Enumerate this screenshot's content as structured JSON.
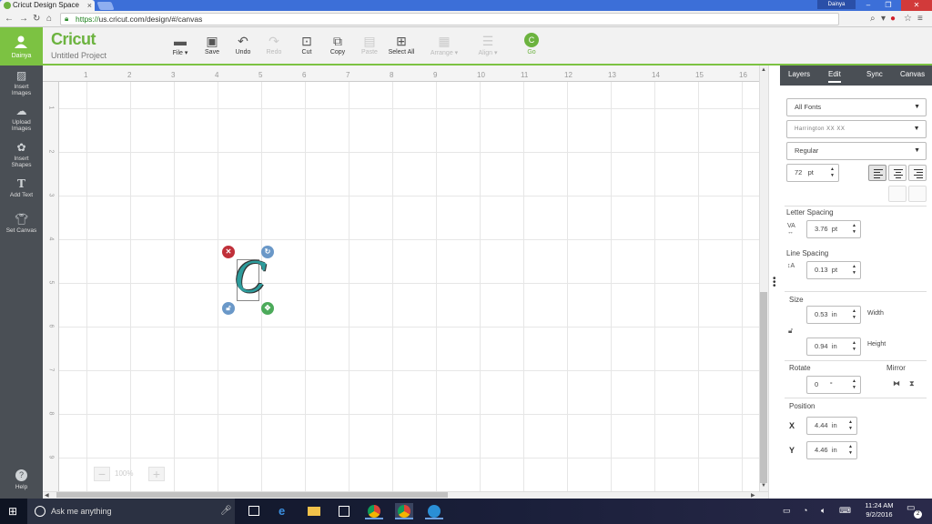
{
  "browser": {
    "tab_title": "Cricut Design Space",
    "tab_close": "×",
    "user_chip": "Dainya",
    "url_secure": "https://",
    "url_rest": "us.cricut.com/design/#/canvas"
  },
  "app": {
    "user_name": "Dainya",
    "logo": "Cricut",
    "project_title": "Untitled Project"
  },
  "toolbar": {
    "file": "File",
    "save": "Save",
    "undo": "Undo",
    "redo": "Redo",
    "cut": "Cut",
    "copy": "Copy",
    "paste": "Paste",
    "select_all": "Select All",
    "arrange": "Arrange",
    "align": "Align",
    "go": "Go"
  },
  "sidebar": {
    "items": [
      {
        "label1": "Insert",
        "label2": "Images"
      },
      {
        "label1": "Upload",
        "label2": "Images"
      },
      {
        "label1": "Insert",
        "label2": "Shapes"
      },
      {
        "label1": "Add Text",
        "label2": ""
      },
      {
        "label1": "Set Canvas",
        "label2": ""
      }
    ],
    "help": "Help"
  },
  "canvas": {
    "ruler_h": [
      "1",
      "2",
      "3",
      "4",
      "5",
      "6",
      "7",
      "8",
      "9",
      "10",
      "11",
      "12",
      "13",
      "14",
      "15",
      "16"
    ],
    "ruler_v": [
      "1",
      "2",
      "3",
      "4",
      "5",
      "6",
      "7",
      "8",
      "9"
    ],
    "zoom": "100%",
    "design_text": "C"
  },
  "panel": {
    "tabs": [
      "Layers",
      "Edit",
      "Sync",
      "Canvas"
    ],
    "font_filter": "All Fonts",
    "font_name": "Harrington XX XX",
    "font_style": "Regular",
    "font_size": "72",
    "font_size_unit": "pt",
    "letter_spacing_label": "Letter Spacing",
    "letter_spacing": "3.76",
    "letter_spacing_unit": "pt",
    "line_spacing_label": "Line Spacing",
    "line_spacing": "0.13",
    "line_spacing_unit": "pt",
    "size_label": "Size",
    "width": "0.53",
    "width_unit": "in",
    "width_label": "Width",
    "height": "0.94",
    "height_unit": "in",
    "height_label": "Height",
    "rotate_label": "Rotate",
    "rotate": "0",
    "rotate_unit": "°",
    "mirror_label": "Mirror",
    "position_label": "Position",
    "x_label": "X",
    "x": "4.44",
    "x_unit": "in",
    "y_label": "Y",
    "y": "4.46",
    "y_unit": "in"
  },
  "taskbar": {
    "search_placeholder": "Ask me anything",
    "time": "11:24 AM",
    "date": "9/2/2016",
    "notifications": "2"
  },
  "colors": {
    "brand_green": "#7cc242",
    "sidebar_gray": "#4a4f55"
  }
}
